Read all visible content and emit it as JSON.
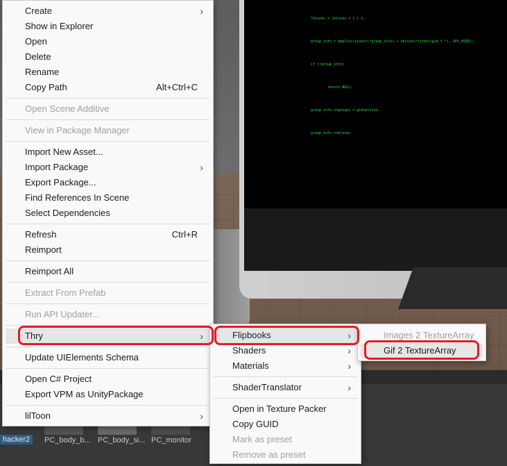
{
  "scene": {
    "code_lines": [
      "      *blocks = (blocks + 1 ) 1;",
      "      group_info = kmalloc(sizeof(*group_info) + nblocks*sizeof(gid_t *), GFP_USER);",
      "      if (!group_info)",
      "              return NULL;",
      "      group_info->ngroups = gidsetsize;",
      "      group_info->nblocks"
    ]
  },
  "project": {
    "assets": [
      {
        "name": "hacker2",
        "selected": true
      },
      {
        "name": "PC_body_b..."
      },
      {
        "name": "PC_body_si..."
      },
      {
        "name": "PC_monitor"
      }
    ]
  },
  "menu_main": {
    "items": [
      {
        "label": "Create",
        "submenu": true
      },
      {
        "label": "Show in Explorer"
      },
      {
        "label": "Open"
      },
      {
        "label": "Delete"
      },
      {
        "label": "Rename"
      },
      {
        "label": "Copy Path",
        "shortcut": "Alt+Ctrl+C"
      },
      {
        "label": "Open Scene Additive",
        "disabled": true
      },
      {
        "label": "View in Package Manager",
        "disabled": true
      },
      {
        "label": "Import New Asset..."
      },
      {
        "label": "Import Package",
        "submenu": true
      },
      {
        "label": "Export Package..."
      },
      {
        "label": "Find References In Scene"
      },
      {
        "label": "Select Dependencies"
      },
      {
        "label": "Refresh",
        "shortcut": "Ctrl+R"
      },
      {
        "label": "Reimport"
      },
      {
        "label": "Reimport All"
      },
      {
        "label": "Extract From Prefab",
        "disabled": true
      },
      {
        "label": "Run API Updater...",
        "disabled": true
      },
      {
        "label": "Thry",
        "submenu": true,
        "hover": true
      },
      {
        "label": "Update UIElements Schema"
      },
      {
        "label": "Open C# Project"
      },
      {
        "label": "Export VPM as UnityPackage"
      },
      {
        "label": "lilToon",
        "submenu": true
      }
    ]
  },
  "menu_thry": {
    "items": [
      {
        "label": "Flipbooks",
        "submenu": true,
        "hover": true
      },
      {
        "label": "Shaders",
        "submenu": true
      },
      {
        "label": "Materials",
        "submenu": true
      },
      {
        "label": "ShaderTranslator",
        "submenu": true
      },
      {
        "label": "Open in Texture Packer"
      },
      {
        "label": "Copy GUID"
      },
      {
        "label": "Mark as preset",
        "disabled": true
      },
      {
        "label": "Remove as preset",
        "disabled": true
      }
    ]
  },
  "menu_flipbooks": {
    "items": [
      {
        "label": "Images 2 TextureArray",
        "disabled": true
      },
      {
        "label": "Gif 2 TextureArray",
        "hover": true
      }
    ]
  },
  "colors": {
    "highlight": "#e31b23",
    "menu_bg": "#f9f9f9",
    "code_green": "#2fe04a"
  }
}
